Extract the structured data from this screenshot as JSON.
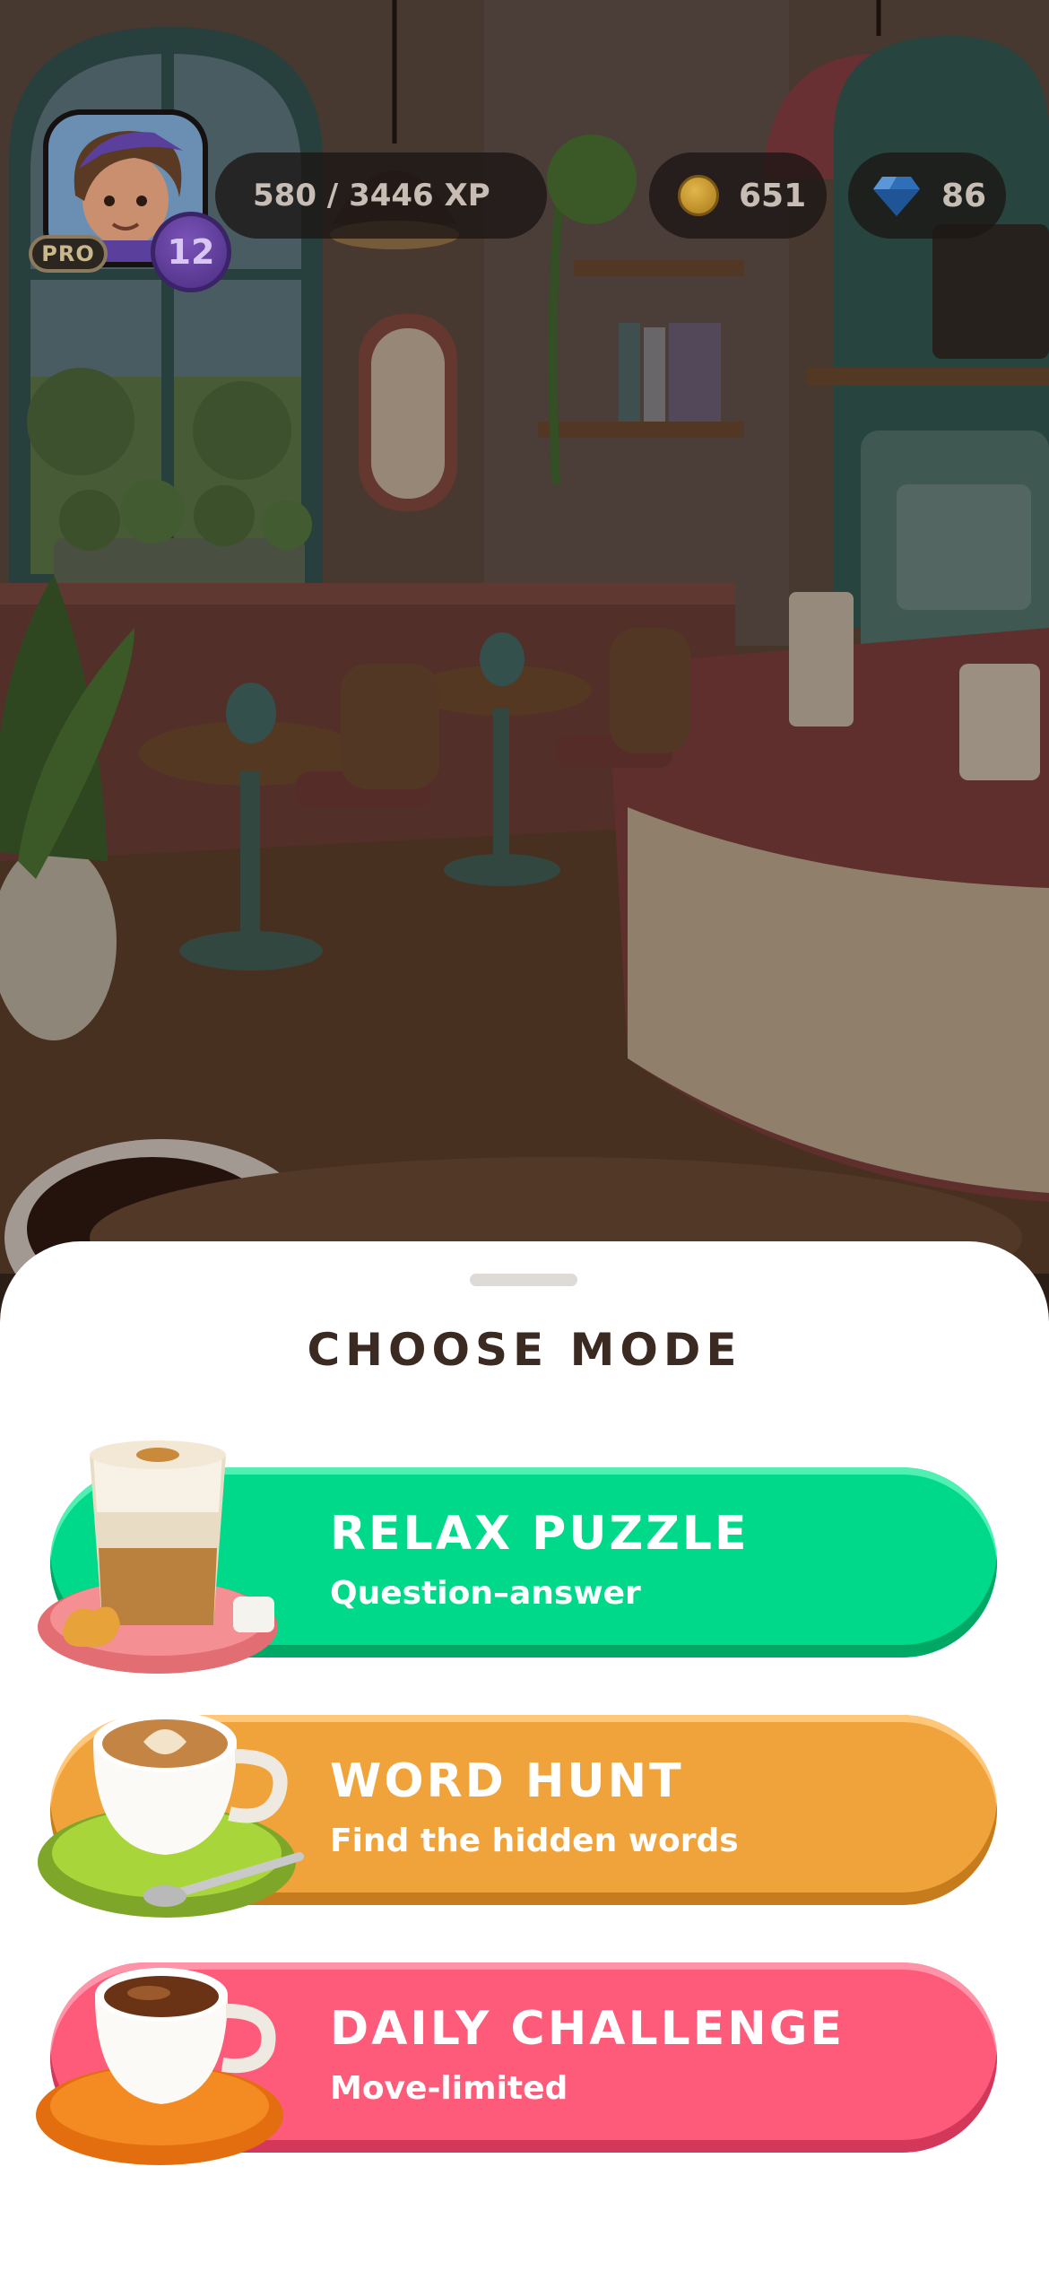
{
  "hud": {
    "pro_label": "PRO",
    "level": "12",
    "xp_text": "580 / 3446 XP",
    "coins": "651",
    "gems": "86"
  },
  "sheet": {
    "title": "CHOOSE MODE"
  },
  "modes": [
    {
      "title": "RELAX PUZZLE",
      "subtitle": "Question–answer",
      "color": "#00d98a",
      "icon": "latte-glass-icon"
    },
    {
      "title": "WORD HUNT",
      "subtitle": "Find the hidden words",
      "color": "#f0a33a",
      "icon": "cappuccino-cup-icon"
    },
    {
      "title": "DAILY CHALLENGE",
      "subtitle": "Move-limited",
      "color": "#fd5b79",
      "icon": "espresso-cup-icon"
    }
  ]
}
